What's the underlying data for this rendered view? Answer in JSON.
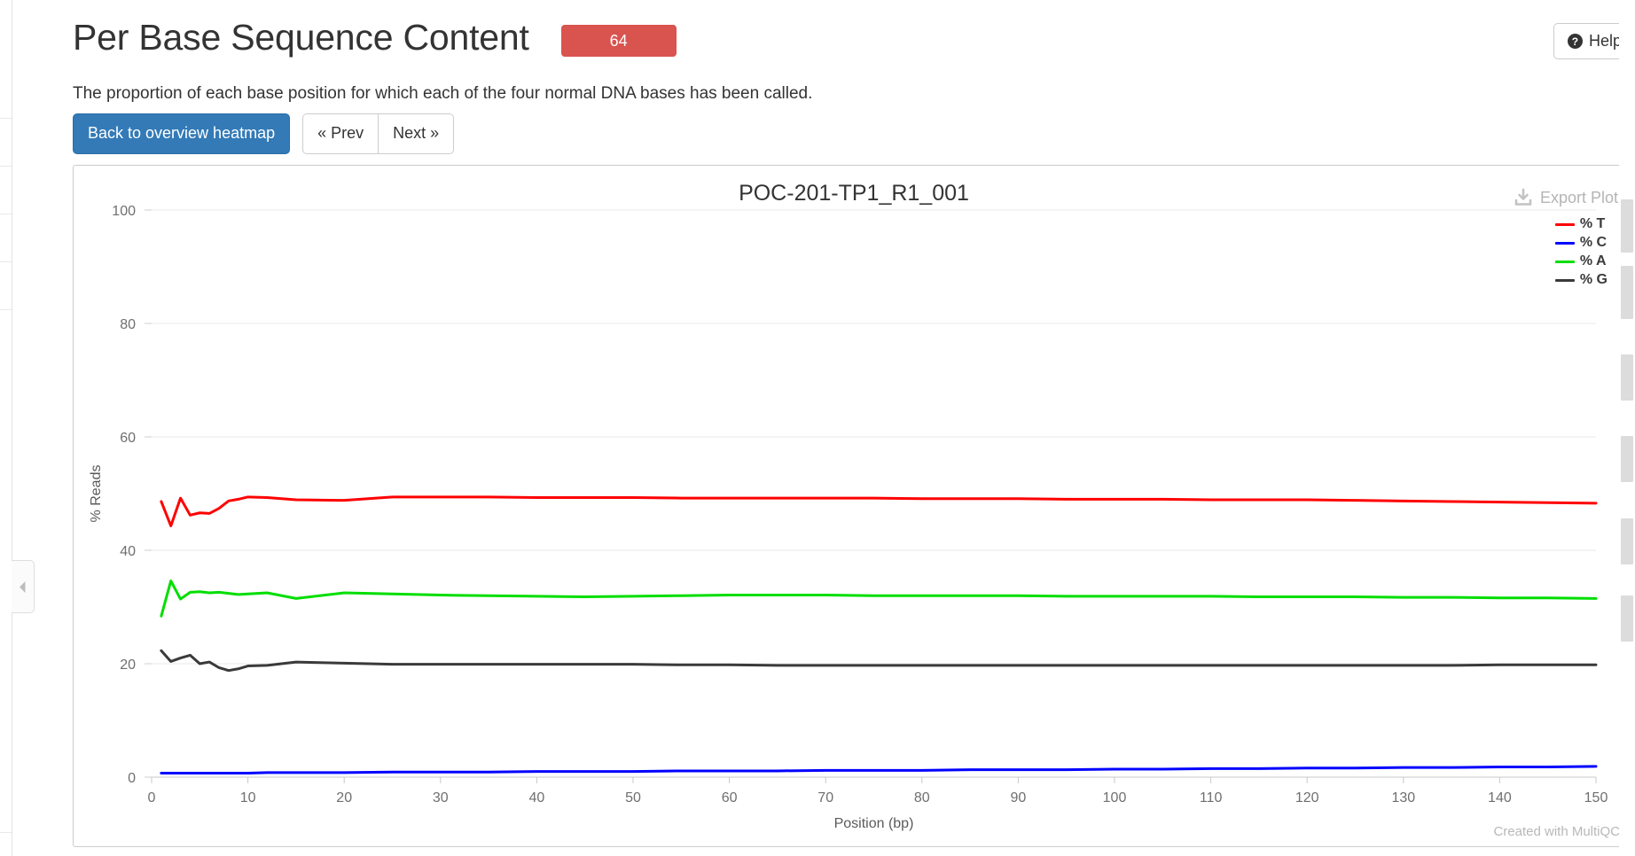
{
  "page": {
    "title": "Per Base Sequence Content",
    "status_badge": "64",
    "badge_color": "#d9534f",
    "subtitle": "The proportion of each base position for which each of the four normal DNA bases has been called.",
    "help_label": "Help",
    "help_icon": "question-circle-icon"
  },
  "toolbar": {
    "back_label": "Back to overview heatmap",
    "prev_label": "« Prev",
    "next_label": "Next »",
    "primary_color": "#337ab7"
  },
  "plot": {
    "export_label": "Export Plot",
    "export_icon": "download-icon",
    "credit": "Created with MultiQC"
  },
  "sidebar": {
    "collapse_icon": "chevron-left-icon"
  },
  "chart_data": {
    "type": "line",
    "title": "POC-201-TP1_R1_001",
    "xlabel": "Position (bp)",
    "ylabel": "% Reads",
    "xlim": [
      0,
      150
    ],
    "ylim": [
      0,
      100
    ],
    "xticks": [
      0,
      10,
      20,
      30,
      40,
      50,
      60,
      70,
      80,
      90,
      100,
      110,
      120,
      130,
      140,
      150
    ],
    "yticks": [
      0,
      20,
      40,
      60,
      80,
      100
    ],
    "grid": true,
    "legend_position": "top-right",
    "x": [
      1,
      2,
      3,
      4,
      5,
      6,
      7,
      8,
      9,
      10,
      12,
      15,
      20,
      25,
      30,
      35,
      40,
      45,
      50,
      55,
      60,
      65,
      70,
      75,
      80,
      85,
      90,
      95,
      100,
      105,
      110,
      115,
      120,
      125,
      130,
      135,
      140,
      145,
      150
    ],
    "series": [
      {
        "name": "% T",
        "color": "#ff0000",
        "values": [
          48.6,
          44.3,
          49.2,
          46.2,
          46.6,
          46.5,
          47.4,
          48.7,
          49.0,
          49.4,
          49.3,
          48.9,
          48.8,
          49.4,
          49.4,
          49.4,
          49.3,
          49.3,
          49.3,
          49.2,
          49.2,
          49.2,
          49.2,
          49.2,
          49.1,
          49.1,
          49.1,
          49.0,
          49.0,
          49.0,
          48.9,
          48.9,
          48.9,
          48.8,
          48.7,
          48.6,
          48.5,
          48.4,
          48.3
        ]
      },
      {
        "name": "% C",
        "color": "#0000ff",
        "values": [
          0.7,
          0.7,
          0.7,
          0.7,
          0.7,
          0.7,
          0.7,
          0.7,
          0.7,
          0.7,
          0.8,
          0.8,
          0.8,
          0.9,
          0.9,
          0.9,
          1.0,
          1.0,
          1.0,
          1.1,
          1.1,
          1.1,
          1.2,
          1.2,
          1.2,
          1.3,
          1.3,
          1.3,
          1.4,
          1.4,
          1.5,
          1.5,
          1.6,
          1.6,
          1.7,
          1.7,
          1.8,
          1.8,
          1.9
        ]
      },
      {
        "name": "% A",
        "color": "#00de00",
        "values": [
          28.4,
          34.6,
          31.4,
          32.6,
          32.7,
          32.5,
          32.6,
          32.4,
          32.2,
          32.3,
          32.5,
          31.5,
          32.5,
          32.3,
          32.1,
          32.0,
          31.9,
          31.8,
          31.9,
          32.0,
          32.1,
          32.1,
          32.1,
          32.0,
          32.0,
          32.0,
          32.0,
          31.9,
          31.9,
          31.9,
          31.9,
          31.8,
          31.8,
          31.8,
          31.7,
          31.7,
          31.6,
          31.6,
          31.5
        ]
      },
      {
        "name": "% G",
        "color": "#3a3a3a",
        "values": [
          22.3,
          20.4,
          21.0,
          21.5,
          20.0,
          20.3,
          19.3,
          18.8,
          19.1,
          19.6,
          19.7,
          20.3,
          20.1,
          19.9,
          19.9,
          19.9,
          19.9,
          19.9,
          19.9,
          19.8,
          19.8,
          19.7,
          19.7,
          19.7,
          19.7,
          19.7,
          19.7,
          19.7,
          19.7,
          19.7,
          19.7,
          19.7,
          19.7,
          19.7,
          19.7,
          19.7,
          19.8,
          19.8,
          19.8
        ]
      }
    ]
  }
}
